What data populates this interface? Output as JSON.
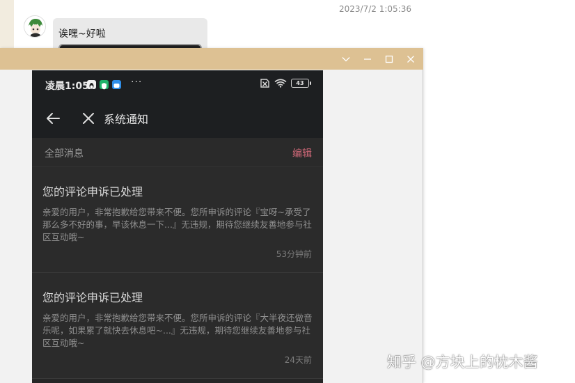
{
  "chat": {
    "timestamp": "2023/7/2 1:05:36",
    "message": "诶嘿~好啦"
  },
  "phone": {
    "status_bar": {
      "time": "凌晨1:05",
      "more": "···",
      "battery": "43"
    },
    "header": {
      "title": "系统通知"
    },
    "filter": {
      "label": "全部消息",
      "edit": "编辑"
    },
    "notifications": [
      {
        "title": "您的评论申诉已处理",
        "body": "亲爱的用户，非常抱歉给您带来不便。您所申诉的评论『宝呀~承受了那么多不好的事，早该休息一下...』无违规，期待您继续友善地参与社区互动哦~",
        "time": "53分钟前"
      },
      {
        "title": "您的评论申诉已处理",
        "body": "亲爱的用户，非常抱歉给您带来不便。您所申诉的评论『大半夜还做音乐呢，如果累了就快去休息吧~...』无违规，期待您继续友善地参与社区互动哦~",
        "time": "24天前"
      }
    ]
  },
  "watermark": "知乎 @方块上的枕木酱",
  "colors": {
    "titlebar": "#ddc193",
    "accent_edit": "#d46a7a",
    "phone_bg": "#262626"
  },
  "icons": {
    "window": [
      "chevron-down-icon",
      "minimize-icon",
      "maximize-icon",
      "close-icon"
    ],
    "header": [
      "back-arrow-icon",
      "close-x-icon"
    ],
    "status": [
      "sim-off-icon",
      "wifi-icon",
      "battery-icon"
    ]
  }
}
